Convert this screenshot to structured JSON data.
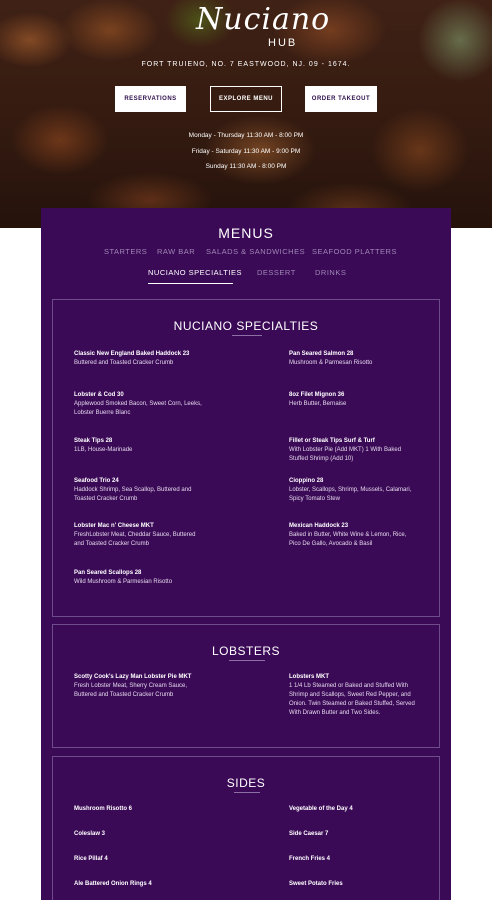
{
  "brand": {
    "script": "Nuciano",
    "sub": "HUB"
  },
  "address": "FORT TRUIENO, NO. 7 EASTWOOD, NJ. 09 - 1674.",
  "buttons": {
    "reservations": "RESERVATIONS",
    "explore": "EXPLORE MENU",
    "takeout": "ORDER TAKEOUT"
  },
  "hours": [
    "Monday - Thursday  11:30 AM - 8:00 PM",
    "Friday - Saturday  11:30 AM - 9:00 PM",
    "Sunday  11:30 AM - 8:00 PM"
  ],
  "menus_title": "MENUS",
  "tabs": [
    {
      "label": "STARTERS",
      "active": false
    },
    {
      "label": "RAW BAR",
      "active": false
    },
    {
      "label": "SALADS & SANDWICHES",
      "active": false
    },
    {
      "label": "SEAFOOD PLATTERS",
      "active": false
    },
    {
      "label": "NUCIANO SPECIALTIES",
      "active": true
    },
    {
      "label": "DESSERT",
      "active": false
    },
    {
      "label": "DRINKS",
      "active": false
    }
  ],
  "specialties": {
    "title": "NUCIANO SPECIALTIES",
    "left": [
      {
        "name": "Classic New England Baked Haddock 23",
        "desc": "Buttered and Toasted Cracker Crumb"
      },
      {
        "name": "Lobster & Cod 30",
        "desc": "Applewood Smoked Bacon, Sweet Corn, Leeks, Lobster Buerre  Blanc"
      },
      {
        "name": "Steak Tips 28",
        "desc": "1LB, House-Marinade"
      },
      {
        "name": "Seafood Trio 24",
        "desc": "Haddock Shrimp, Sea Scallop, Buttered and Toasted Cracker Crumb"
      },
      {
        "name": "Lobster Mac n' Cheese MKT",
        "desc": "FreshLobster Meat, Cheddar Sauce, Buttered and Toasted Cracker Crumb"
      },
      {
        "name": "Pan Seared Scallops 28",
        "desc": "Wild Mushroom & Parmesian Risotto"
      }
    ],
    "right": [
      {
        "name": "Pan Seared Salmon 28",
        "desc": "Mushroom & Parmesan Risotto"
      },
      {
        "name": "8oz Filet Mignon 36",
        "desc": "Herb Butter, Bernaise"
      },
      {
        "name": "Fillet or Steak Tips Surf & Turf",
        "desc": "With Lobster Pie (Add MKT) 1 With Baked Stuffed Shrimp (Add 10)"
      },
      {
        "name": "Cioppino 28",
        "desc": "Lobster, Scallops, Shrimp, Mussels, Calamari, Spicy Tomato Stew"
      },
      {
        "name": "Mexican Haddock 23",
        "desc": "Baked in Butter, White Wine & Lemon, Rice, Pico De Gallo, Avocado & Basil"
      }
    ]
  },
  "lobsters": {
    "title": "LOBSTERS",
    "left": {
      "name": "Scotty Cook's Lazy Man Lobster Pie MKT",
      "desc": "Fresh Lobster Meat, Sherry Cream Sauce, Buttered and Toasted Cracker Crumb"
    },
    "right": {
      "name": "Lobsters MKT",
      "desc": "1 1/4 Lb Steamed or Baked and Stuffed With Shrimp and Scallops, Sweet Red Pepper, and Onion. Twin Steamed or Baked Stuffed, Served With Drawn Butter and Two Sides."
    }
  },
  "sides": {
    "title": "SIDES",
    "left": [
      "Mushroom Risotto 6",
      "Coleslaw 3",
      "Rice Pillaf 4",
      "Ale Battered Onion Rings 4"
    ],
    "right": [
      "Vegetable of the Day 4",
      "Side Caesar 7",
      "French Fries 4",
      "Sweet Potato Fries"
    ]
  }
}
